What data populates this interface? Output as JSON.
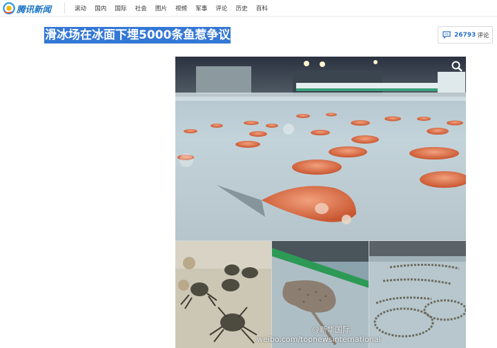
{
  "header": {
    "logo_text": "腾讯新闻",
    "nav": [
      "滚动",
      "国内",
      "国际",
      "社会",
      "图片",
      "视频",
      "军事",
      "评论",
      "历史",
      "百科"
    ]
  },
  "article": {
    "title": "滑冰场在冰面下埋5000条鱼惹争议",
    "comments": {
      "count": "26793",
      "label": "评论"
    }
  },
  "image": {
    "watermark_name": "@新华国际",
    "watermark_url": "weibo.com/topnewsinternational"
  },
  "colors": {
    "brand_blue": "#1a74c4",
    "title_highlight": "#3478d6",
    "comment_count": "#2b70c4"
  }
}
